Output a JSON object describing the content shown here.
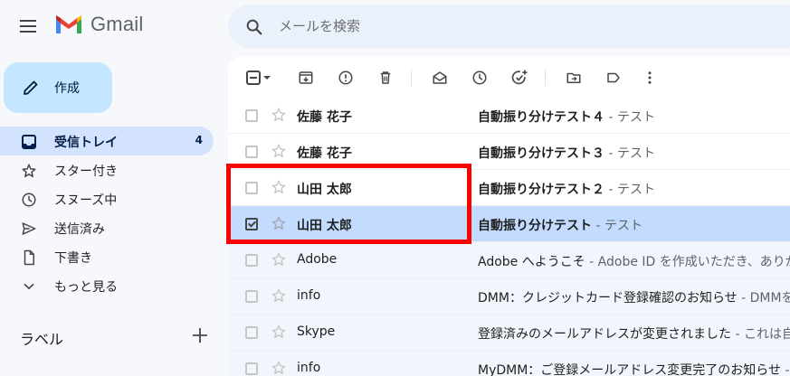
{
  "app": {
    "logo_text": "Gmail"
  },
  "search": {
    "placeholder": "メールを検索"
  },
  "compose": {
    "label": "作成"
  },
  "nav": {
    "items": [
      {
        "label": "受信トレイ",
        "count": "4",
        "icon": "inbox-icon",
        "active": true
      },
      {
        "label": "スター付き",
        "icon": "star-icon"
      },
      {
        "label": "スヌーズ中",
        "icon": "clock-icon"
      },
      {
        "label": "送信済み",
        "icon": "send-icon"
      },
      {
        "label": "下書き",
        "icon": "draft-icon"
      },
      {
        "label": "もっと見る",
        "icon": "chevron-down-icon"
      }
    ]
  },
  "labels": {
    "title": "ラベル"
  },
  "toolbar": {
    "buttons": [
      "select-all-checkbox",
      "select-dropdown",
      "archive-icon",
      "report-spam-icon",
      "delete-icon",
      "mark-read-icon",
      "snooze-icon",
      "add-task-icon",
      "move-to-icon",
      "label-icon",
      "more-icon"
    ]
  },
  "emails": [
    {
      "sender": "佐藤 花子",
      "subject": "自動振り分けテスト４",
      "snippet": " - テスト",
      "unread": true,
      "selected": false
    },
    {
      "sender": "佐藤 花子",
      "subject": "自動振り分けテスト３",
      "snippet": " - テスト",
      "unread": true,
      "selected": false
    },
    {
      "sender": "山田 太郎",
      "subject": "自動振り分けテスト２",
      "snippet": " - テスト",
      "unread": true,
      "selected": false
    },
    {
      "sender": "山田 太郎",
      "subject": "自動振り分けテスト",
      "snippet": " - テスト",
      "unread": true,
      "selected": true
    },
    {
      "sender": "Adobe",
      "subject": "Adobe へようこそ",
      "snippet": " - Adobe ID を作成いただき、ありが",
      "unread": false,
      "selected": false
    },
    {
      "sender": "info",
      "subject": "DMM：クレジットカード登録確認のお知らせ",
      "snippet": " - DMMを",
      "unread": false,
      "selected": false
    },
    {
      "sender": "Skype",
      "subject": "登録済みのメールアドレスが変更されました",
      "snippet": " - これは自",
      "unread": false,
      "selected": false
    },
    {
      "sender": "info",
      "subject": "MyDMM：ご登録メールアドレス変更完了のお知らせ",
      "snippet": " - ",
      "unread": false,
      "selected": false
    }
  ],
  "colors": {
    "highlight": "#ff0000",
    "selected_row": "#c2dbff",
    "compose_bg": "#c2e7ff",
    "active_nav": "#d3e3fd"
  }
}
